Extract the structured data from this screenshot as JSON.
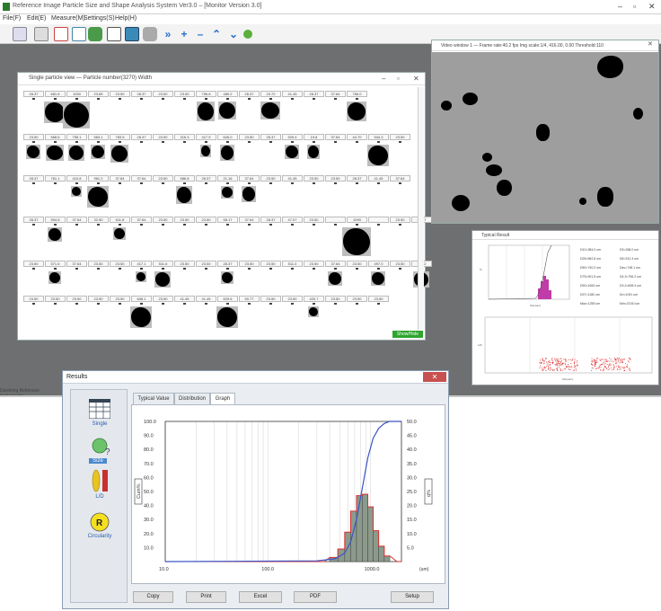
{
  "app": {
    "title": "Reference Image Particle Size and Shape Analysis System Ver3.0 – [Monitor Version 3.0]",
    "menu": [
      "File(F)",
      "Edit(E)",
      "Measure(M)",
      "Settings(S)",
      "Help(H)"
    ],
    "status_left": "Dandong Bettersize Instruments",
    "window_controls": [
      "–",
      "▫",
      "✕"
    ]
  },
  "single_particle": {
    "title": "Single particle view — Particle number(3270)  Width",
    "rows": [
      [
        "28.37",
        "681.6",
        "1050",
        "23.65",
        "23.50",
        "28.37",
        "23.50",
        "23.50",
        "796.8",
        "489.2",
        "28.37",
        "23.72",
        "41.45",
        "28.37",
        "37.64",
        "766.0"
      ],
      [
        "23.50",
        "568.6",
        "755.1",
        "563.1",
        "783.5",
        "28.37",
        "23.50",
        "316.3",
        "417.9",
        "626.0",
        "23.50",
        "28.37",
        "529.4",
        "19.8",
        "37.64",
        "44.70",
        "544.3",
        "23.50"
      ],
      [
        "28.37",
        "761.1",
        "410.8",
        "961.2",
        "37.84",
        "37.64",
        "23.50",
        "586.8",
        "28.37",
        "21.16",
        "37.64",
        "23.50",
        "41.45",
        "23.50",
        "23.50",
        "28.37",
        "41.45",
        "37.64"
      ],
      [
        "28.37",
        "594.8",
        "37.64",
        "32.50",
        "611.8",
        "37.64",
        "23.50",
        "23.50",
        "23.50",
        "58.17",
        "37.64",
        "28.37",
        "47.07",
        "23.50",
        "",
        "1090",
        "",
        "23.50",
        "28.37"
      ],
      [
        "23.50",
        "571.6",
        "37.64",
        "23.50",
        "23.50",
        "417.1",
        "511.6",
        "23.50",
        "23.50",
        "28.37",
        "23.50",
        "23.50",
        "511.0",
        "23.50",
        "37.64",
        "23.50",
        "497.0",
        "23.50",
        "702.2"
      ],
      [
        "23.50",
        "23.50",
        "23.50",
        "23.50",
        "23.50",
        "608.1",
        "23.50",
        "41.45",
        "41.45",
        "629.6",
        "50.77",
        "23.50",
        "23.50",
        "420.7",
        "23.50",
        "23.50",
        "23.50"
      ]
    ],
    "show_hide": "Show/Hide"
  },
  "video": {
    "title": "Video window 1  —  Frame rate:40.2 fps   Img scale:1/4,  416.00,   0.00    Threshold:110"
  },
  "typical": {
    "title": "Typical Result",
    "stats_left": [
      "D10=384.0 um",
      "D25=562.8 um",
      "D50=740.2 um",
      "D75=901.5 um",
      "D90=1063 um",
      "D97=1180 um",
      "Max=1255 um"
    ],
    "stats_right": [
      "D3=268.0 um",
      "D6=312.4 um",
      "Dav=748.1 um",
      "D4,3=756.2 um",
      "D3,2=698.4 um",
      "Dn=1091 um",
      "Min=23.50 um"
    ],
    "dist_xlabel": "Size(um)",
    "dist_ylabel": "%",
    "scatter_xlabel": "Size(um)",
    "scatter_ylabel": "L/D"
  },
  "results": {
    "title": "Results",
    "close": "✕",
    "side_labels": [
      "Single",
      "Size",
      "L/D",
      "Circularity"
    ],
    "tabs": [
      "Typical Value",
      "Distribution",
      "Graph"
    ],
    "active_tab": "Graph",
    "buttons": [
      "Copy",
      "Print",
      "Excel",
      "PDF",
      "Setup"
    ],
    "colors": {
      "cum": "#3a55c8",
      "diff": "#d83030",
      "bar": "#8c9a8c"
    }
  },
  "chart_data": {
    "type": "bar",
    "x_scale": "log",
    "xlim": [
      10.0,
      2000.0
    ],
    "ylim_left": [
      0.0,
      100.0
    ],
    "ylim_right": [
      0.0,
      50.0
    ],
    "y_left_ticks": [
      "100.0",
      "90.0",
      "80.0",
      "70.0",
      "60.0",
      "50.0",
      "40.0",
      "30.0",
      "20.0",
      "10.0"
    ],
    "y_right_ticks": [
      "50.0",
      "45.0",
      "40.0",
      "35.0",
      "30.0",
      "25.0",
      "20.0",
      "15.0",
      "10.0",
      "5.0"
    ],
    "x_ticks": [
      "10.0",
      "100.0",
      "1000.0"
    ],
    "x_unit": "(um)",
    "ylabel_left": "Cum%",
    "ylabel_right": "q%",
    "grid": true,
    "bins": [
      {
        "x0": 400,
        "x1": 480,
        "q": 1.5
      },
      {
        "x0": 480,
        "x1": 560,
        "q": 4.5
      },
      {
        "x0": 560,
        "x1": 640,
        "q": 10.5
      },
      {
        "x0": 640,
        "x1": 730,
        "q": 18.0
      },
      {
        "x0": 730,
        "x1": 830,
        "q": 23.5
      },
      {
        "x0": 830,
        "x1": 940,
        "q": 24.0
      },
      {
        "x0": 940,
        "x1": 1060,
        "q": 19.5
      },
      {
        "x0": 1060,
        "x1": 1200,
        "q": 11.0
      },
      {
        "x0": 1200,
        "x1": 1360,
        "q": 5.5
      },
      {
        "x0": 1360,
        "x1": 1540,
        "q": 2.0
      }
    ],
    "cumulative": {
      "x": [
        10,
        300,
        450,
        560,
        640,
        730,
        830,
        940,
        1060,
        1200,
        1360,
        1540,
        2000
      ],
      "y": [
        0,
        0.5,
        2,
        6,
        14,
        30,
        52,
        74,
        88,
        95,
        98.5,
        100,
        100
      ]
    }
  }
}
